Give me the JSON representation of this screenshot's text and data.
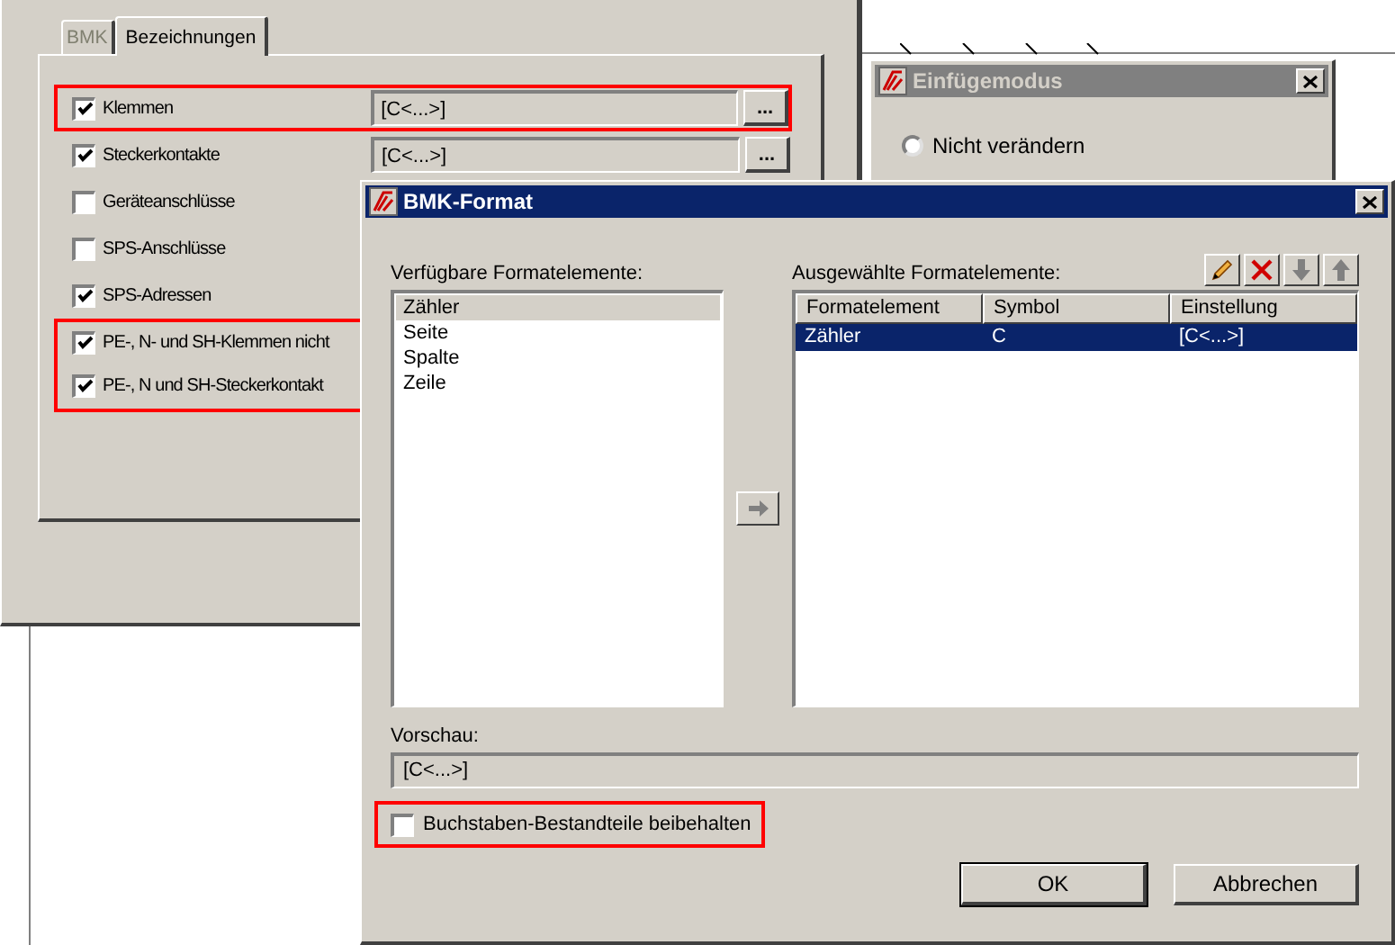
{
  "back_dialog": {
    "tabs": [
      {
        "label": "BMK",
        "selected": false
      },
      {
        "label": "Bezeichnungen",
        "selected": true
      }
    ],
    "rows": [
      {
        "label": "Klemmen",
        "checked": true,
        "highlighted": true,
        "value": "[C<...>]",
        "button": "..."
      },
      {
        "label": "Steckerkontakte",
        "checked": true,
        "highlighted": false,
        "value": "[C<...>]",
        "button": "..."
      },
      {
        "label": "Geräteanschlüsse",
        "checked": false,
        "highlighted": false
      },
      {
        "label": "SPS-Anschlüsse",
        "checked": false,
        "highlighted": false
      },
      {
        "label": "SPS-Adressen",
        "checked": true,
        "highlighted": false
      },
      {
        "label": "PE-, N- und SH-Klemmen nicht",
        "checked": true,
        "highlighted": true
      },
      {
        "label": "PE-, N und SH-Steckerkontakt",
        "checked": true,
        "highlighted": true
      }
    ]
  },
  "insert_dialog": {
    "title": "Einfügemodus",
    "active": false,
    "options": [
      {
        "label": "Nicht verändern",
        "selected": false
      }
    ]
  },
  "format_dialog": {
    "title": "BMK-Format",
    "active": true,
    "available": {
      "label": "Verfügbare Formatelemente:",
      "items": [
        {
          "label": "Zähler",
          "selected": true
        },
        {
          "label": "Seite",
          "selected": false
        },
        {
          "label": "Spalte",
          "selected": false
        },
        {
          "label": "Zeile",
          "selected": false
        }
      ]
    },
    "add_button": {
      "disabled": true
    },
    "selected_elements": {
      "label": "Ausgewählte Formatelemente:",
      "toolbar": [
        {
          "kind": "edit",
          "disabled": false
        },
        {
          "kind": "delete",
          "disabled": false
        },
        {
          "kind": "down",
          "disabled": true
        },
        {
          "kind": "up",
          "disabled": true
        }
      ],
      "columns": [
        "Formatelement",
        "Symbol",
        "Einstellung"
      ],
      "rows": [
        {
          "cells": [
            "Zähler",
            "C",
            "[C<...>]"
          ],
          "selected": true
        }
      ]
    },
    "preview": {
      "label": "Vorschau:",
      "value": "[C<...>]",
      "disabled": true
    },
    "keep_letters": {
      "label": "Buchstaben-Bestandteile beibehalten",
      "checked": false,
      "highlighted": true
    },
    "buttons": [
      {
        "label": "OK",
        "default": true
      },
      {
        "label": "Abbrechen",
        "default": false
      }
    ]
  }
}
